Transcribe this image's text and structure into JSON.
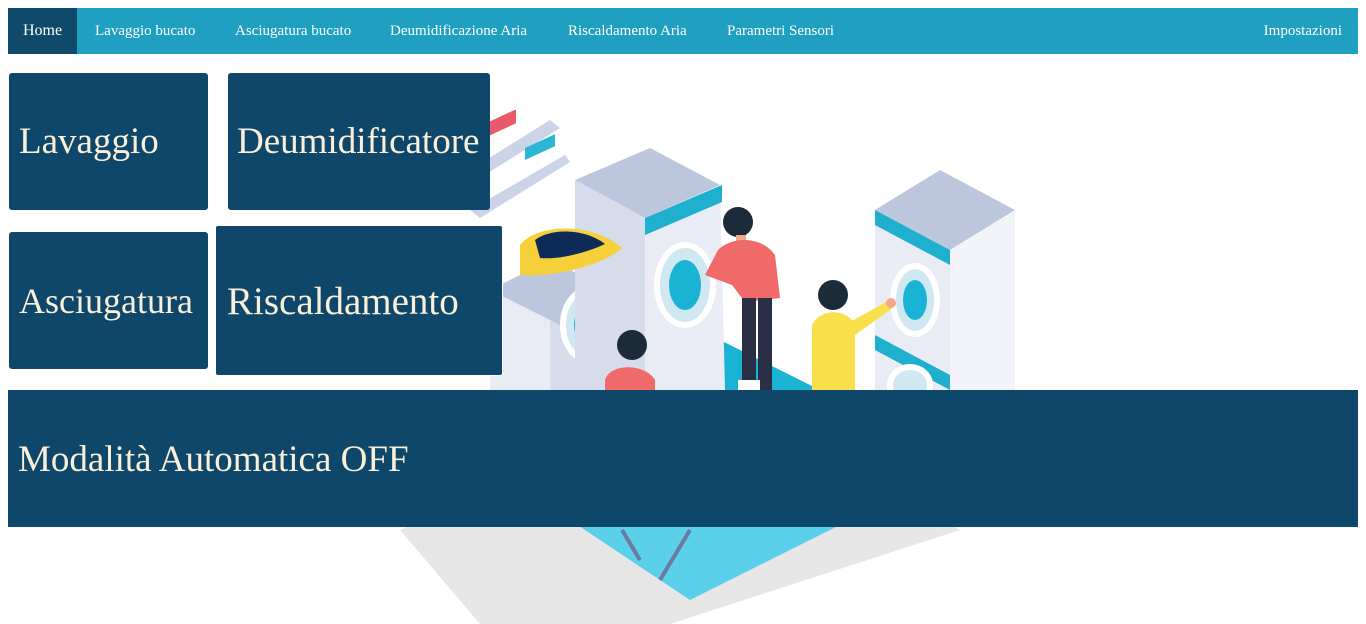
{
  "navbar": {
    "items": [
      {
        "label": "Home"
      },
      {
        "label": "Lavaggio bucato"
      },
      {
        "label": "Asciugatura bucato"
      },
      {
        "label": "Deumidificazione Aria"
      },
      {
        "label": "Riscaldamento Aria"
      },
      {
        "label": "Parametri Sensori"
      }
    ],
    "settings_label": "Impostazioni"
  },
  "tiles": {
    "lavaggio": "Lavaggio",
    "deumidificatore": "Deumidificatore",
    "asciugatura": "Asciugatura",
    "riscaldamento": "Riscaldamento"
  },
  "auto_mode": {
    "label": "Modalità Automatica OFF"
  },
  "colors": {
    "navbar": "#20a0c0",
    "nav_active": "#0f4a6b",
    "tile": "#0e476a",
    "tile_text": "#faefd9"
  },
  "illustration": "laundromat-illustration"
}
